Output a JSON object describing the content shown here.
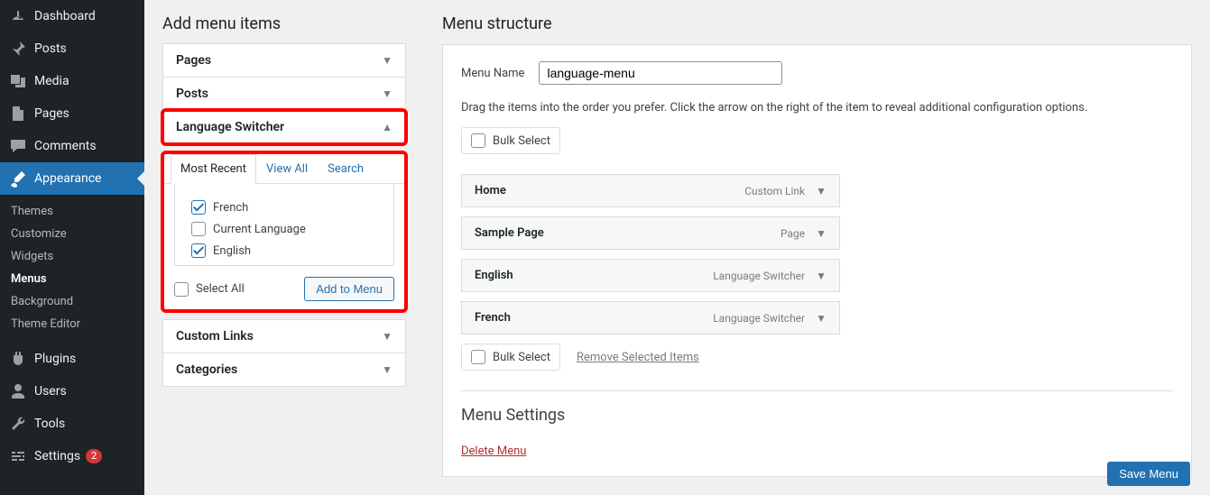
{
  "sidebar": {
    "items": [
      {
        "label": "Dashboard"
      },
      {
        "label": "Posts"
      },
      {
        "label": "Media"
      },
      {
        "label": "Pages"
      },
      {
        "label": "Comments"
      },
      {
        "label": "Appearance"
      },
      {
        "label": "Plugins"
      },
      {
        "label": "Users"
      },
      {
        "label": "Tools"
      },
      {
        "label": "Settings"
      }
    ],
    "settings_badge": "2",
    "appearance_sub": [
      {
        "label": "Themes"
      },
      {
        "label": "Customize"
      },
      {
        "label": "Widgets"
      },
      {
        "label": "Menus"
      },
      {
        "label": "Background"
      },
      {
        "label": "Theme Editor"
      }
    ]
  },
  "add_panel": {
    "title": "Add menu items",
    "sections": {
      "pages": "Pages",
      "posts": "Posts",
      "lang": "Language Switcher",
      "custom": "Custom Links",
      "cats": "Categories"
    },
    "tabs": {
      "recent": "Most Recent",
      "viewall": "View All",
      "search": "Search"
    },
    "langs": {
      "french": "French",
      "current": "Current Language",
      "english": "English"
    },
    "select_all": "Select All",
    "add_btn": "Add to Menu"
  },
  "structure": {
    "title": "Menu structure",
    "name_label": "Menu Name",
    "name_value": "language-menu",
    "help": "Drag the items into the order you prefer. Click the arrow on the right of the item to reveal additional configuration options.",
    "bulk": "Bulk Select",
    "remove": "Remove Selected Items",
    "items": [
      {
        "title": "Home",
        "type": "Custom Link"
      },
      {
        "title": "Sample Page",
        "type": "Page"
      },
      {
        "title": "English",
        "type": "Language Switcher"
      },
      {
        "title": "French",
        "type": "Language Switcher"
      }
    ],
    "settings_head": "Menu Settings",
    "delete": "Delete Menu",
    "save": "Save Menu"
  }
}
